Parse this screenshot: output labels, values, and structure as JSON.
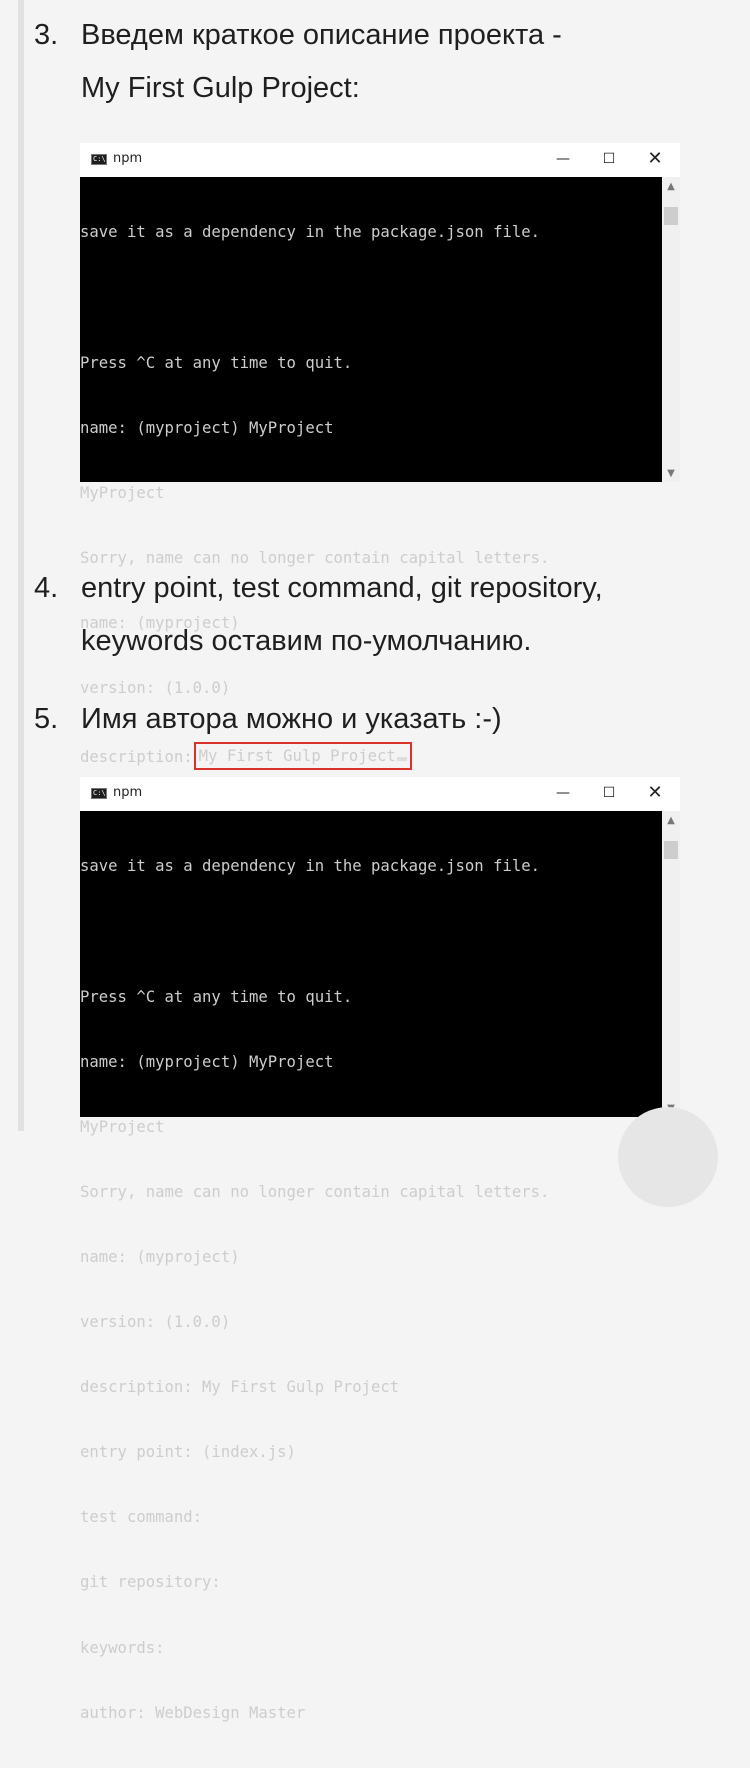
{
  "steps": [
    {
      "number": "3.",
      "lines": [
        "Введем краткое описание проекта -",
        "My First Gulp Project:"
      ]
    },
    {
      "number": "4.",
      "lines": [
        "entry point, test command, git repository,",
        "keywords оставим по-умолчанию."
      ]
    },
    {
      "number": "5.",
      "lines": [
        "Имя автора можно и указать :-)"
      ]
    }
  ],
  "window1": {
    "title": "npm",
    "icon": "cmd-icon",
    "controls": {
      "minimize": "—",
      "maximize": "☐",
      "close": "✕"
    },
    "lines": [
      "save it as a dependency in the package.json file.",
      "",
      "Press ^C at any time to quit.",
      "name: (myproject) MyProject",
      "MyProject",
      "Sorry, name can no longer contain capital letters.",
      "name: (myproject)",
      "version: (1.0.0)"
    ],
    "description_prompt": "description:",
    "description_value": "My First Gulp Project",
    "highlight_color": "#d8322a"
  },
  "window2": {
    "title": "npm",
    "icon": "cmd-icon",
    "controls": {
      "minimize": "—",
      "maximize": "☐",
      "close": "✕"
    },
    "lines": [
      "save it as a dependency in the package.json file.",
      "",
      "Press ^C at any time to quit.",
      "name: (myproject) MyProject",
      "MyProject",
      "Sorry, name can no longer contain capital letters.",
      "name: (myproject)",
      "version: (1.0.0)",
      "description: My First Gulp Project",
      "entry point: (index.js)",
      "test command:",
      "git repository:",
      "keywords:",
      "author: WebDesign Master"
    ]
  }
}
